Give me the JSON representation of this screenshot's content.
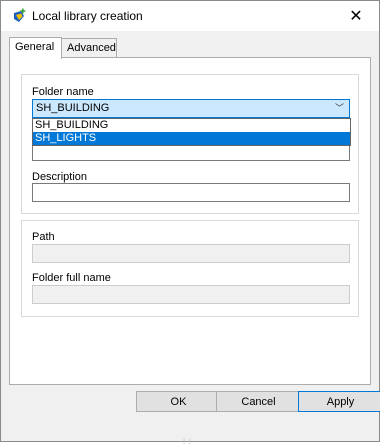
{
  "window": {
    "title": "Local library creation",
    "close_glyph": "✕"
  },
  "tabs": [
    {
      "label": "General",
      "active": true
    },
    {
      "label": "Advanced",
      "active": false
    }
  ],
  "form": {
    "folder_name_label": "Folder name",
    "folder_name_value": "SH_BUILDING",
    "dropdown_options": [
      "SH_BUILDING",
      "SH_LIGHTS"
    ],
    "dropdown_highlighted": "SH_LIGHTS",
    "description_label": "Description",
    "description_value": "",
    "path_label": "Path",
    "path_value": "",
    "full_name_label": "Folder full name",
    "full_name_value": ""
  },
  "buttons": {
    "ok": "OK",
    "cancel": "Cancel",
    "apply": "Apply"
  },
  "colors": {
    "accent": "#0078d7",
    "combo_bg": "#cce8ff",
    "icon_green": "#3aa53a",
    "icon_blue": "#1f5fbf"
  }
}
